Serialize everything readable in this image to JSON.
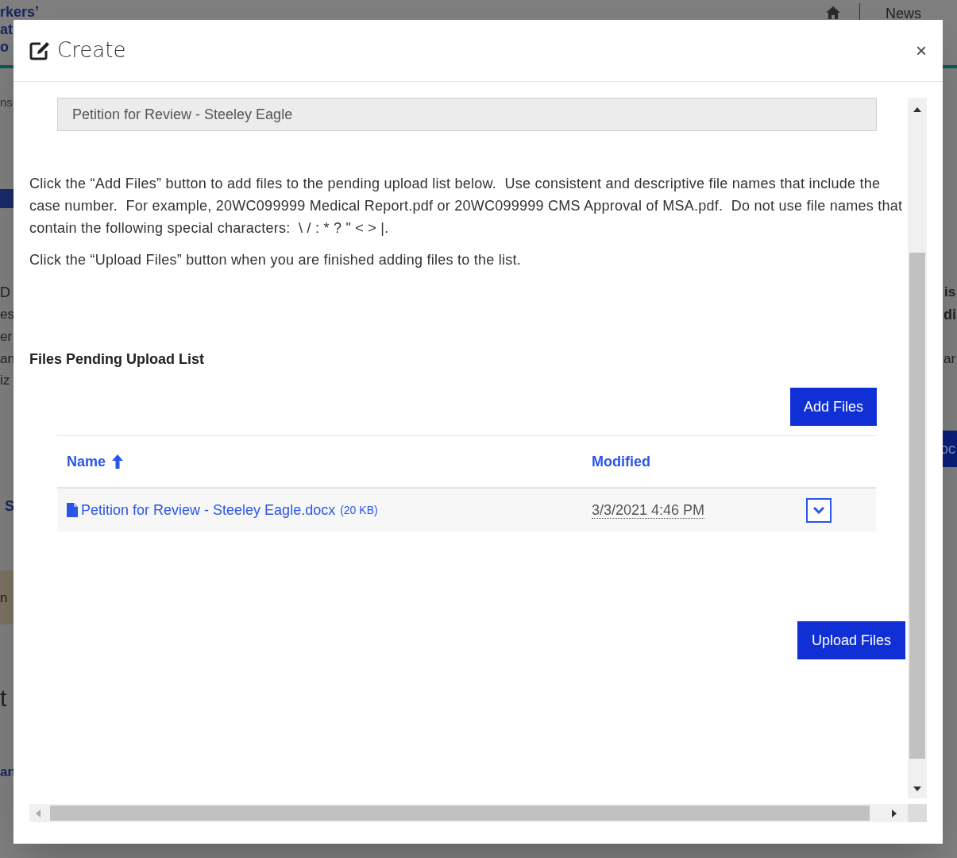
{
  "background": {
    "fragments": [
      "rkers’",
      "at",
      "o",
      "News",
      "ns",
      "D",
      "es",
      "er",
      "an",
      "iz",
      "S",
      "n",
      "t",
      "an",
      "is",
      "di",
      "ar",
      "oc"
    ]
  },
  "dialog": {
    "title": "Create",
    "close": "×",
    "document_title": "Petition for Review - Steeley Eagle",
    "instructions": [
      "Click the “Add Files” button to add files to the pending upload list below.  Use consistent and descriptive file names that include the case number.  For example, 20WC099999 Medical Report.pdf or 20WC099999 CMS Approval of MSA.pdf.  Do not use file names that contain the following special characters:  \\ / : * ? \" < > |.",
      "Click the “Upload Files” button when you are finished adding files to the list."
    ],
    "list_heading": "Files Pending Upload List",
    "add_button": "Add Files",
    "table": {
      "columns": [
        {
          "label": "Name",
          "sorted": true
        },
        {
          "label": "Modified",
          "sorted": false
        }
      ],
      "rows": [
        {
          "name": "Petition for Review - Steeley Eagle.docx",
          "size": "(20 KB)",
          "modified": "3/3/2021 4:46 PM"
        }
      ]
    },
    "upload_button": "Upload Files"
  }
}
